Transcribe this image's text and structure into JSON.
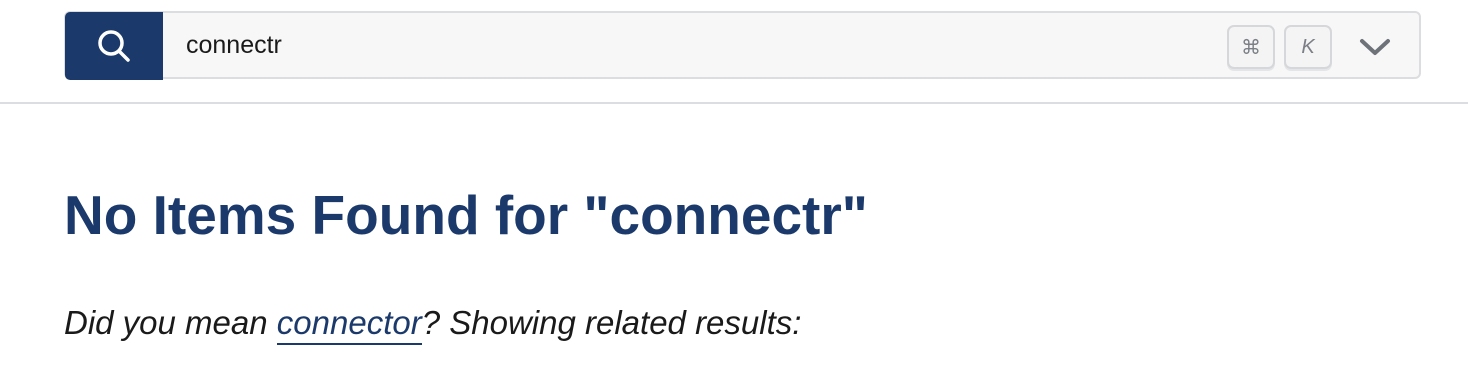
{
  "search": {
    "value": "connectr",
    "shortcut_modifier": "⌘",
    "shortcut_key": "K"
  },
  "results": {
    "heading": "No Items Found for \"connectr\"",
    "did_you_mean_prefix": "Did you mean ",
    "suggestion_link": "connector",
    "did_you_mean_suffix": "?  Showing related results:"
  },
  "colors": {
    "accent": "#1b3a6b",
    "border": "#dcdde0",
    "search_bg": "#f7f7f8"
  },
  "icons": {
    "search_button": "search-icon",
    "dropdown": "chevron-down-icon"
  }
}
